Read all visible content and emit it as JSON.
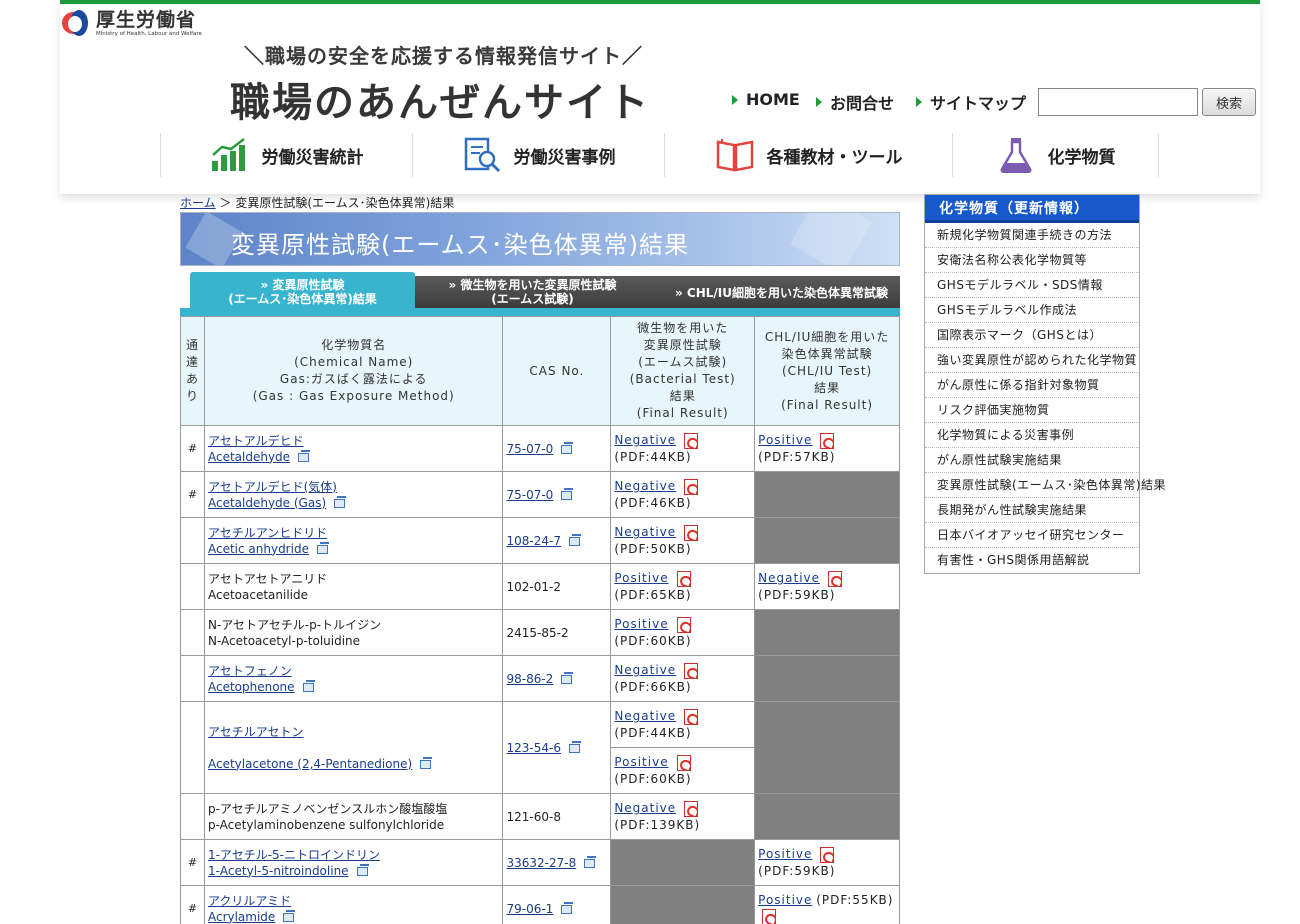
{
  "ministry": {
    "name_jp": "厚生労働省",
    "name_en": "Ministry of Health, Labour and Welfare"
  },
  "site": {
    "tagline": "＼職場の安全を応援する情報発信サイト／",
    "title": "職場のあんぜんサイト"
  },
  "topnav": {
    "home": "HOME",
    "contact": "お問合せ",
    "sitemap": "サイトマップ"
  },
  "search": {
    "value": "",
    "button": "検索"
  },
  "gnav": [
    "労働災害統計",
    "労働災害事例",
    "各種教材・ツール",
    "化学物質"
  ],
  "breadcrumb": {
    "home": "ホーム",
    "sep": "＞",
    "current": "変異原性試験(エームス･染色体異常)結果"
  },
  "page_title": "変異原性試験(エームス･染色体異常)結果",
  "tabs": {
    "t1": {
      "line1": "» 変異原性試験",
      "line2": "(エームス･染色体異常)結果"
    },
    "t2": {
      "line1": "» 微生物を用いた変異原性試験",
      "line2": "(エームス試験)"
    },
    "t3": {
      "line1": "» CHL/IU細胞を用いた染色体異常試験"
    }
  },
  "table": {
    "headers": {
      "col0": [
        "通",
        "達",
        "あ",
        "り"
      ],
      "col1": [
        "化学物質名",
        "(Chemical Name)",
        "Gas:ガスばく露法による",
        "(Gas : Gas Exposure Method)"
      ],
      "col2": "CAS No.",
      "col3": [
        "微生物を用いた",
        "変異原性試験",
        "(エームス試験)",
        "(Bacterial Test)",
        "結果",
        "(Final Result)"
      ],
      "col4": [
        "CHL/IU細胞を用いた",
        "染色体異常試験",
        "(CHL/IU Test)",
        "結果",
        "(Final Result)"
      ]
    },
    "rows": [
      {
        "mark": "#",
        "jp": "アセトアルデヒド",
        "en": "Acetaldehyde",
        "cas": "75-07-0",
        "b1": "Negative",
        "b1s": "(PDF:44KB)",
        "c": "Positive",
        "cs": "(PDF:57KB)"
      },
      {
        "mark": "#",
        "jp": "アセトアルデヒド(気体)",
        "en": "Acetaldehyde (Gas)",
        "cas": "75-07-0",
        "b1": "Negative",
        "b1s": "(PDF:46KB)"
      },
      {
        "mark": "",
        "jp": "アセチルアンヒドリド",
        "en": "Acetic anhydride",
        "cas": "108-24-7",
        "b1": "Negative",
        "b1s": "(PDF:50KB)"
      },
      {
        "mark": "",
        "jp": "アセトアセトアニリド",
        "en": "Acetoacetanilide",
        "cas": "102-01-2",
        "b1": "Positive",
        "b1s": "(PDF:65KB)",
        "c": "Negative",
        "cs": "(PDF:59KB)"
      },
      {
        "mark": "",
        "jp": "N-アセトアセチル-p-トルイジン",
        "en": "N-Acetoacetyl-p-toluidine",
        "cas": "2415-85-2",
        "b1": "Positive",
        "b1s": "(PDF:60KB)"
      },
      {
        "mark": "",
        "jp": "アセトフェノン",
        "en": "Acetophenone",
        "cas": "98-86-2",
        "b1": "Negative",
        "b1s": "(PDF:66KB)"
      },
      {
        "mark": "",
        "jp": "アセチルアセトン",
        "en": "Acetylacetone (2,4-Pentanedione)",
        "cas": "123-54-6",
        "b1": "Negative",
        "b1s": "(PDF:44KB)",
        "b2": "Positive",
        "b2s": "(PDF:60KB)"
      },
      {
        "mark": "",
        "jp": "p-アセチルアミノベンゼンスルホン酸塩酸塩",
        "en": "p-Acetylaminobenzene sulfonylchloride",
        "cas": "121-60-8",
        "b1": "Negative",
        "b1s": "(PDF:139KB)"
      },
      {
        "mark": "#",
        "jp": "1-アセチル-5-ニトロインドリン",
        "en": "1-Acetyl-5-nitroindoline",
        "cas": "33632-27-8",
        "c": "Positive",
        "cs": "(PDF:59KB)"
      },
      {
        "mark": "#",
        "jp": "アクリルアミド",
        "en": "Acrylamide",
        "cas": "79-06-1",
        "c": "Positive",
        "cs": "(PDF:55KB)"
      }
    ]
  },
  "sidebar": {
    "title": "化学物質（更新情報）",
    "items": [
      "新規化学物質関連手続きの方法",
      "安衛法名称公表化学物質等",
      "GHSモデルラベル・SDS情報",
      "GHSモデルラベル作成法",
      "国際表示マーク（GHSとは）",
      "強い変異原性が認められた化学物質",
      "がん原性に係る指針対象物質",
      "リスク評価実施物質",
      "化学物質による災害事例",
      "がん原性試験実施結果",
      "変異原性試験(エームス･染色体異常)結果",
      "長期発がん性試験実施結果",
      "日本バイオアッセイ研究センター",
      "有害性・GHS関係用語解説"
    ]
  }
}
